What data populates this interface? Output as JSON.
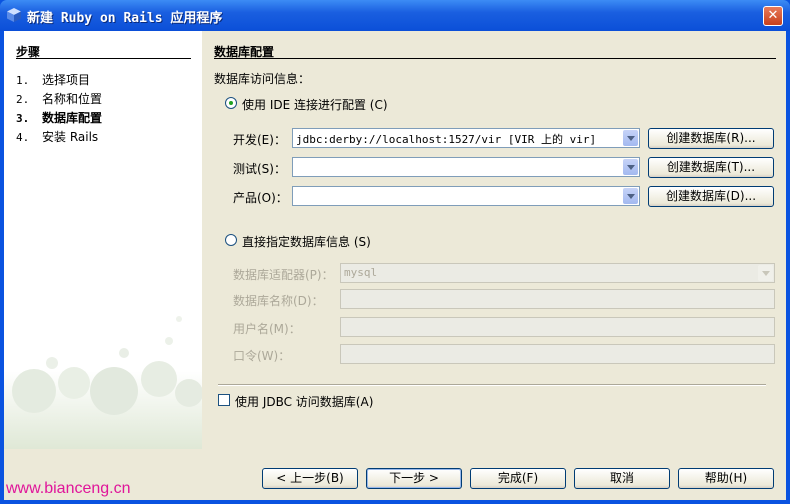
{
  "window": {
    "title": "新建 Ruby on Rails 应用程序",
    "close_label": "✕"
  },
  "steps": {
    "title": "步骤",
    "items": [
      {
        "num": "1.",
        "label": "选择项目"
      },
      {
        "num": "2.",
        "label": "名称和位置"
      },
      {
        "num": "3.",
        "label": "数据库配置",
        "current": true
      },
      {
        "num": "4.",
        "label": "安装 Rails"
      }
    ]
  },
  "panel": {
    "title": "数据库配置",
    "access_info": "数据库访问信息：",
    "use_ide": {
      "label": "使用 IDE 连接进行配置 (C)",
      "selected": true
    },
    "dev": {
      "label": "开发(E)：",
      "value": "jdbc:derby://localhost:1527/vir [VIR 上的 vir]",
      "button": "创建数据库(R)..."
    },
    "test": {
      "label": "测试(S)：",
      "value": "",
      "button": "创建数据库(T)..."
    },
    "prod": {
      "label": "产品(O)：",
      "value": "",
      "button": "创建数据库(D)..."
    },
    "direct": {
      "label": "直接指定数据库信息 (S)",
      "selected": false
    },
    "adapter": {
      "label": "数据库适配器(P)：",
      "value": "mysql"
    },
    "db_name": {
      "label": "数据库名称(D)：",
      "value": ""
    },
    "username": {
      "label": "用户名(M)：",
      "value": ""
    },
    "password": {
      "label": "口令(W)：",
      "value": ""
    },
    "use_jdbc": {
      "label": "使用 JDBC 访问数据库(A)",
      "checked": false
    }
  },
  "footer": {
    "back": "< 上一步(B)",
    "next": "下一步 >",
    "finish": "完成(F)",
    "cancel": "取消",
    "help": "帮助(H)"
  },
  "watermark": "www.bianceng.cn",
  "colors": {
    "titlebar": "#0b4fd8",
    "dialog_bg": "#ece9d8",
    "watermark": "#e0159a",
    "radio_dot": "#21a121"
  }
}
